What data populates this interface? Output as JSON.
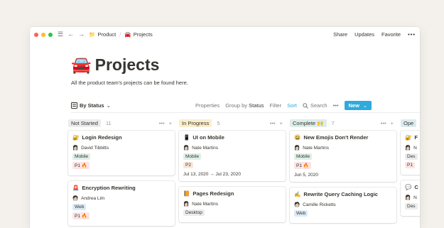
{
  "colors": {
    "mobile": "#dfefe9",
    "web": "#dbeaf6",
    "desktop": "#ebeced",
    "p1": "#fbe4e4",
    "p2": "#fbe7d9",
    "accent": "#2eaadc"
  },
  "topbar": {
    "breadcrumb": [
      {
        "icon": "folder-icon",
        "glyph": "📁",
        "label": "Product"
      },
      {
        "icon": "car-icon",
        "glyph": "🚘",
        "label": "Projects"
      }
    ],
    "actions": [
      "Share",
      "Updates",
      "Favorite"
    ],
    "more": "•••"
  },
  "page": {
    "emoji": "🚘",
    "title": "Projects",
    "description": "All the product team's projects can be found here."
  },
  "viewbar": {
    "view_label": "By Status",
    "properties": "Properties",
    "group_by": "Group by",
    "group_by_value": "Status",
    "filter": "Filter",
    "sort": "Sort",
    "search": "Search",
    "more": "•••",
    "new": "New"
  },
  "columns": [
    {
      "name": "Not Started",
      "count": "11",
      "tag_bg": "#ebeced",
      "cards": [
        {
          "emoji": "🔐",
          "title": "Login Redesign",
          "avatar": "👩🏻",
          "person": "David Tibbitts",
          "tags": [
            {
              "text": "Mobile",
              "kind": "mobile"
            },
            {
              "text": "P1 🔥",
              "kind": "p1"
            }
          ],
          "date": ""
        },
        {
          "emoji": "🚨",
          "title": "Encryption Rewriting",
          "avatar": "🧑🏻",
          "person": "Andrea Lim",
          "tags": [
            {
              "text": "Web",
              "kind": "web"
            },
            {
              "text": "P1 🔥",
              "kind": "p1"
            }
          ],
          "date": ""
        }
      ]
    },
    {
      "name": "In Progress",
      "count": "5",
      "tag_bg": "#fbeecc",
      "cards": [
        {
          "emoji": "📱",
          "title": "UI on Mobile",
          "avatar": "👩🏻",
          "person": "Nate Martins",
          "tags": [
            {
              "text": "Mobile",
              "kind": "mobile"
            },
            {
              "text": "P2",
              "kind": "p2"
            }
          ],
          "date": "Jul 13, 2020 → Jul 23, 2020"
        },
        {
          "emoji": "📙",
          "title": "Pages Redesign",
          "avatar": "👩🏻",
          "person": "Nate Martins",
          "tags": [
            {
              "text": "Desktop",
              "kind": "desktop"
            }
          ],
          "date": ""
        }
      ]
    },
    {
      "name": "Complete 🙌",
      "count": "7",
      "tag_bg": "#ddedea",
      "cards": [
        {
          "emoji": "😀",
          "title": "New Emojis Don't Render",
          "avatar": "👩🏻",
          "person": "Nate Martins",
          "tags": [
            {
              "text": "Mobile",
              "kind": "mobile"
            },
            {
              "text": "P1 🔥",
              "kind": "p1"
            }
          ],
          "date": "Jun 5, 2020"
        },
        {
          "emoji": "✍️",
          "title": "Rewrite Query Caching Logic",
          "avatar": "🧑🏻",
          "person": "Camille Ricketts",
          "tags": [
            {
              "text": "Web",
              "kind": "web"
            }
          ],
          "date": ""
        }
      ]
    },
    {
      "name": "Ope",
      "count": "",
      "tag_bg": "#ddebf1",
      "cards": [
        {
          "emoji": "🔐",
          "title": "F",
          "avatar": "👩🏻",
          "person": "N",
          "tags": [
            {
              "text": "Des",
              "kind": "desktop"
            },
            {
              "text": "P1",
              "kind": "p1"
            }
          ],
          "date": ""
        },
        {
          "emoji": "💬",
          "title": "C",
          "avatar": "👩🏻",
          "person": "N",
          "tags": [
            {
              "text": "Des",
              "kind": "desktop"
            }
          ],
          "date": ""
        }
      ]
    }
  ]
}
